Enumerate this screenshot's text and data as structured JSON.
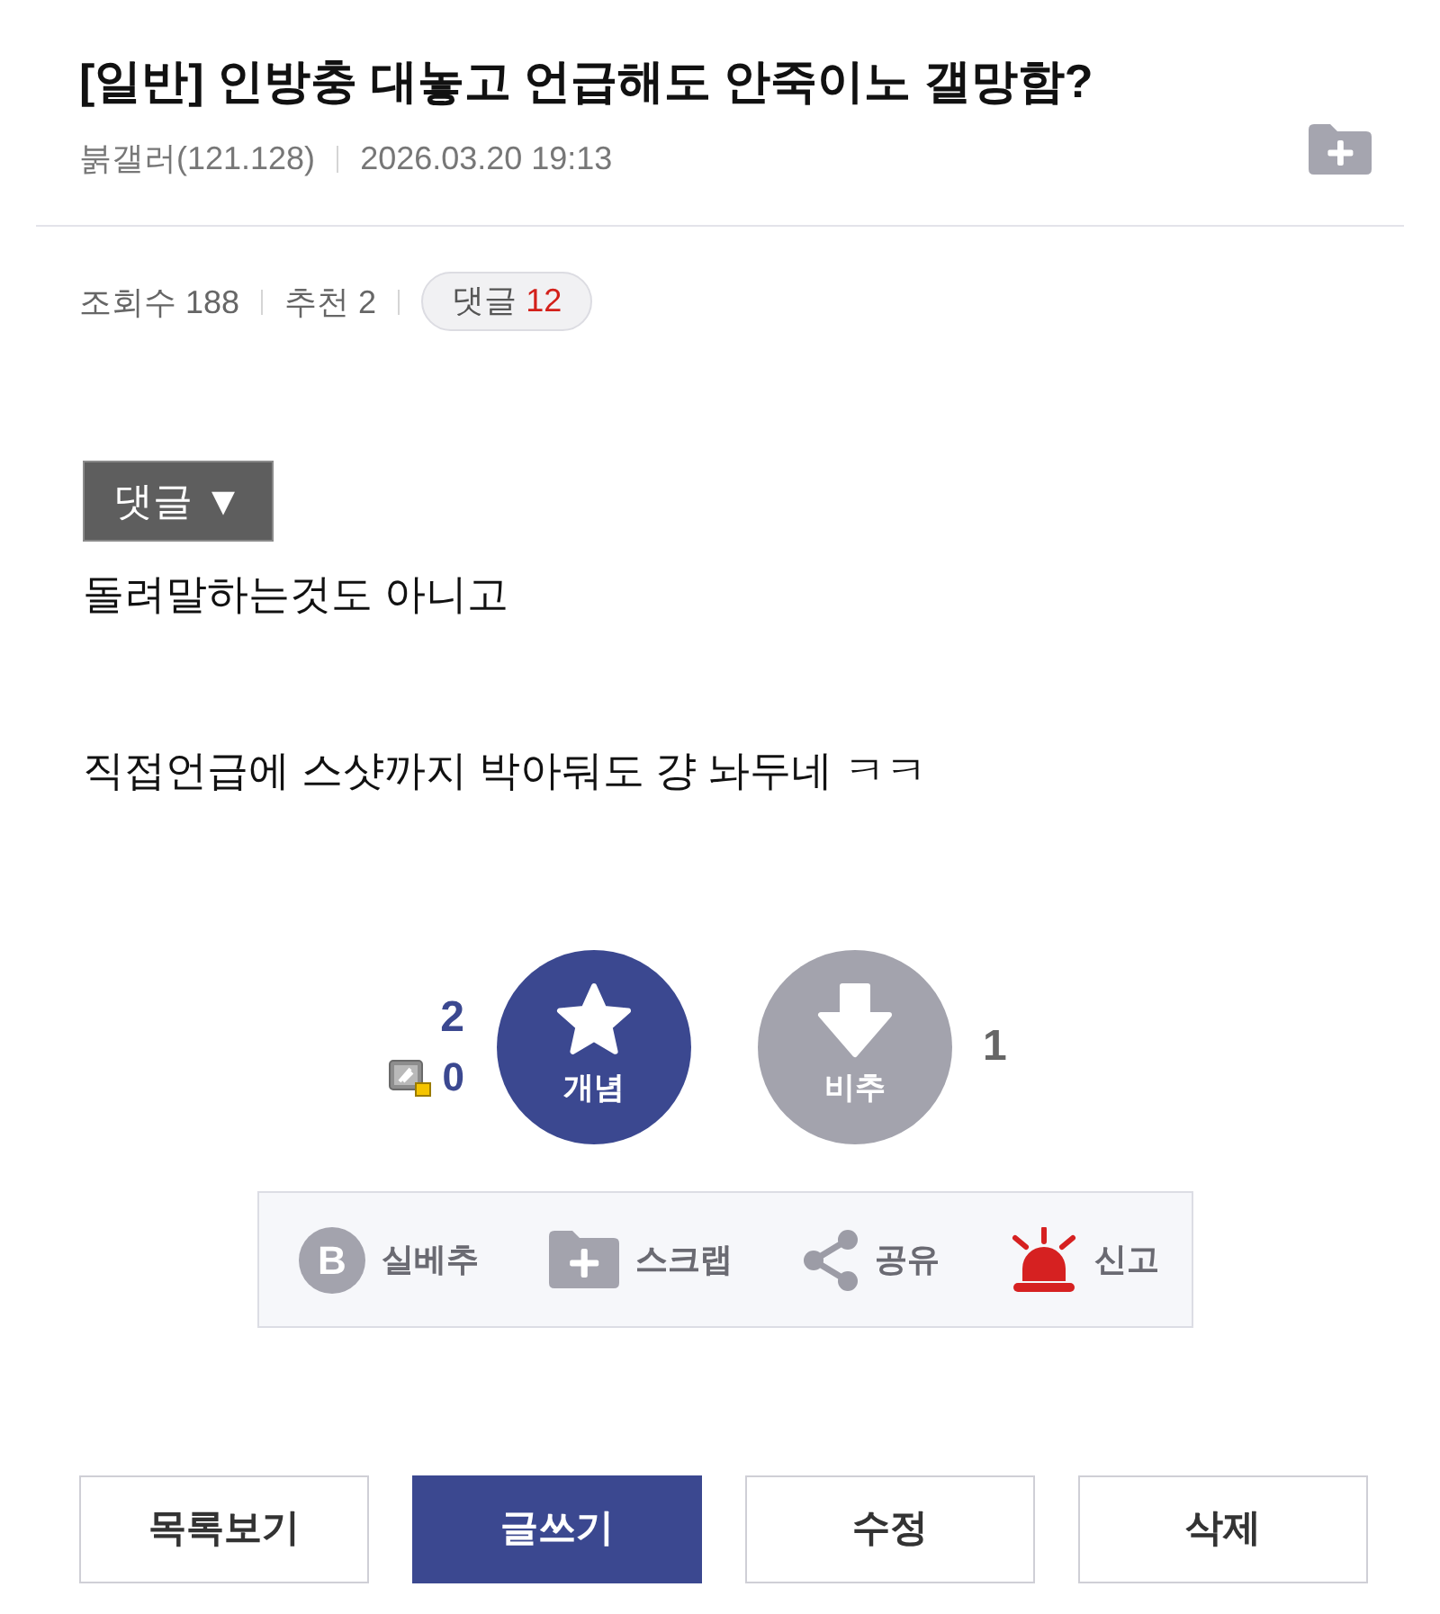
{
  "post": {
    "title": "[일반] 인방충 대놓고 언급해도 안죽이노 갤망함?",
    "author": "붉갤러(121.128)",
    "date": "2026.03.20 19:13"
  },
  "stats": [
    {
      "label": "조회수",
      "value": "188"
    },
    {
      "label": "추천",
      "value": "2"
    }
  ],
  "comments": {
    "label": "댓글",
    "count": "12"
  },
  "comment_toggle": {
    "label": "댓글 ▼"
  },
  "body": [
    "돌려말하는것도 아니고",
    "직접언급에 스샷까지 박아둬도 걍 놔두네 ㅋㅋ"
  ],
  "upvote": {
    "label": "개념",
    "count": "2",
    "fixed_count": "0"
  },
  "downvote": {
    "label": "비추",
    "count": "1"
  },
  "actions": [
    {
      "kind": "best",
      "icon_text": "B",
      "label": "실베추"
    },
    {
      "kind": "scrap",
      "label": "스크랩"
    },
    {
      "kind": "share",
      "label": "공유"
    },
    {
      "kind": "report",
      "label": "신고"
    }
  ],
  "buttons": [
    {
      "label": "목록보기",
      "primary": false
    },
    {
      "label": "글쓰기",
      "primary": true
    },
    {
      "label": "수정",
      "primary": false
    },
    {
      "label": "삭제",
      "primary": false
    }
  ]
}
